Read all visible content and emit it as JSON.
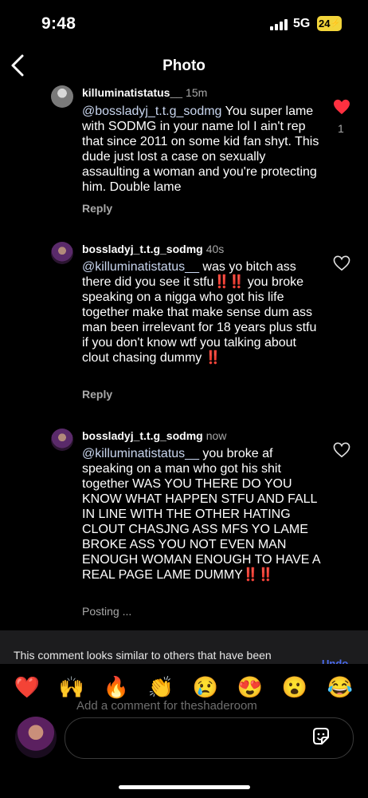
{
  "status_bar": {
    "time": "9:48",
    "network": "5G",
    "battery": "24"
  },
  "header": {
    "title": "Photo"
  },
  "comments": [
    {
      "username": "killuminatistatus__",
      "time": "15m",
      "mention": "@bossladyj_t.t.g_sodmg",
      "text": " You super lame with SODMG in your name lol I ain't rep that since 2011 on some kid fan shyt. This dude just lost a case on sexually assaulting a woman and you're protecting him. Double lame",
      "action": "Reply",
      "likes": "1",
      "liked": true
    },
    {
      "username": "bossladyj_t.t.g_sodmg",
      "time": "40s",
      "mention": "@killuminatistatus__",
      "text_1": " was yo bitch ass there did you see it stfu",
      "emphasis_1": "‼️‼️",
      "text_2": " you broke speaking on a nigga who got his life together make that make sense dum ass man been irrelevant for 18 years plus stfu if you don't know wtf you talking about clout chasing dummy ",
      "emphasis_2": "‼️",
      "action": "Reply",
      "liked": false
    },
    {
      "username": "bossladyj_t.t.g_sodmg",
      "time": "now",
      "mention": "@killuminatistatus__",
      "text": " you broke af speaking on a man who got his shit together WAS YOU THERE DO YOU KNOW WHAT HAPPEN STFU AND FALL IN LINE WITH THE OTHER HATING CLOUT CHASJNG ASS MFS YO LAME BROKE ASS YOU NOT EVEN MAN ENOUGH WOMAN ENOUGH TO HAVE A REAL PAGE LAME DUMMY",
      "emphasis": "‼️‼️",
      "action": "Posting ...",
      "liked": false
    }
  ],
  "warning": {
    "text": "This comment looks similar to others that have been",
    "undo": "Undo"
  },
  "reactions": [
    "❤️",
    "🙌",
    "🔥",
    "👏",
    "😢",
    "😍",
    "😮",
    "😂"
  ],
  "composer": {
    "placeholder": "Add a comment for theshaderoom"
  },
  "colors": {
    "like_red": "#ff3040",
    "mention": "#c9d6ef",
    "secondary": "#a8a8a8",
    "undo_blue": "#4b6cf0"
  }
}
